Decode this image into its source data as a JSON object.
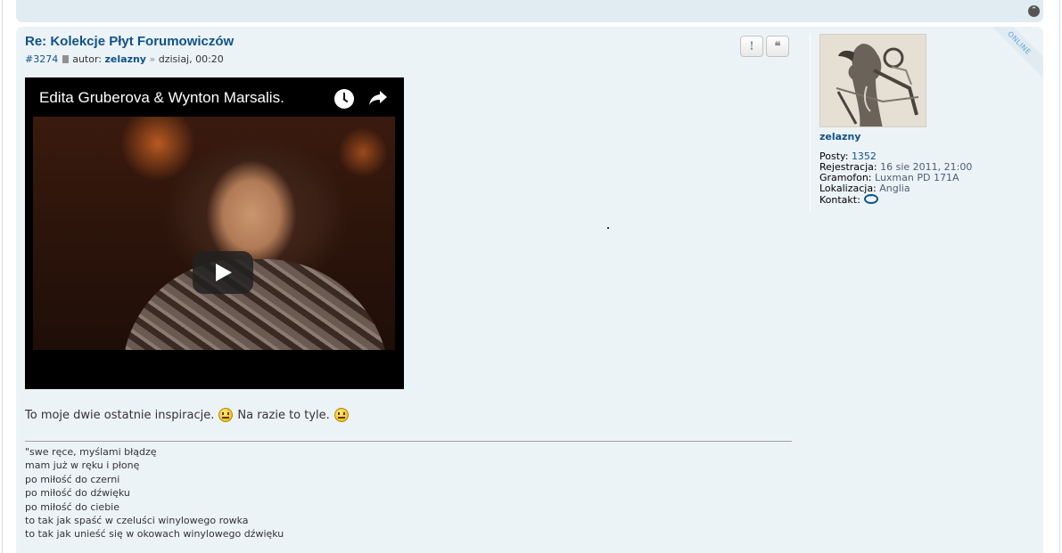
{
  "post": {
    "title": "Re: Kolekcje Płyt Forumowiczów",
    "number": "#3274",
    "author_prefix": "autor:",
    "author": "zelazny",
    "separator": "»",
    "date": "dzisiaj, 00:20",
    "buttons": {
      "report": "!",
      "quote": "❝"
    },
    "video": {
      "title": "Edita Gruberova & Wynton Marsalis."
    },
    "stray_mark": ".",
    "content": {
      "text1": "To moje dwie ostatnie inspiracje.",
      "text2": "Na razie to tyle."
    },
    "signature": [
      "\"swe ręce, myślami błądzę",
      "mam już w ręku i płonę",
      "po miłość do czerni",
      "po miłość do dźwięku",
      "po miłość do ciebie",
      "to tak jak spaść w czeluści winylowego rowka",
      "to tak jak unieść się w okowach winylowego dźwięku"
    ]
  },
  "profile": {
    "username": "zelazny",
    "online_label": "ONLINE",
    "posts_label": "Posty:",
    "posts": "1352",
    "registered_label": "Rejestracja:",
    "registered": "16 sie 2011, 21:00",
    "gramofon_label": "Gramofon:",
    "gramofon": "Luxman PD 171A",
    "location_label": "Lokalizacja:",
    "location": "Anglia",
    "contact_label": "Kontakt:"
  },
  "icons": {
    "back_to_top": "chevron-up-icon",
    "file": "file-icon",
    "watch_later": "clock-icon",
    "share": "share-icon",
    "play": "play-icon",
    "smiley": "smiley-icon",
    "contact": "speech-bubble-icon"
  },
  "colors": {
    "link": "#105289",
    "post_bg": "#ecf3f7",
    "header_bg": "#e1ebf2"
  }
}
